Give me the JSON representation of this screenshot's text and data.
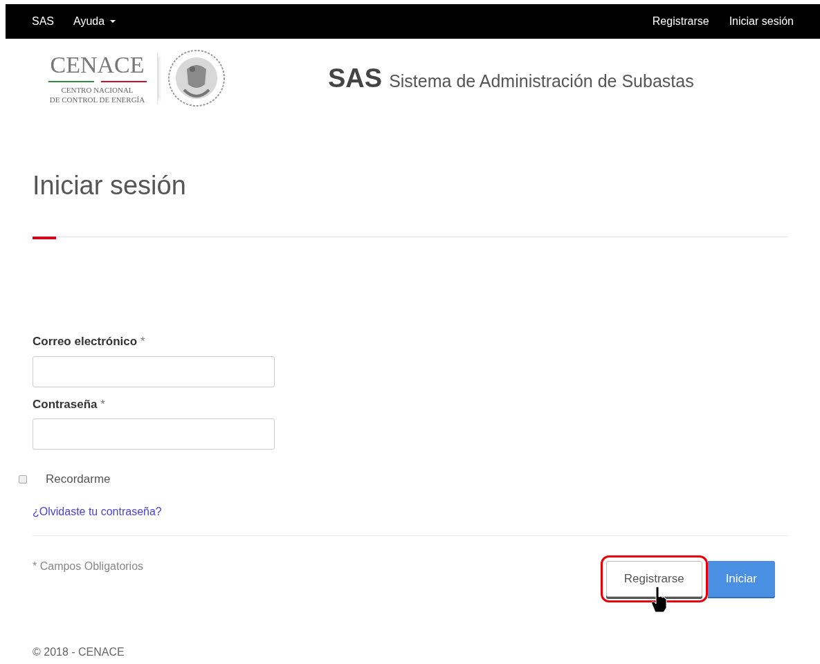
{
  "navbar": {
    "brand": "SAS",
    "menu": {
      "label": "Ayuda"
    },
    "links": [
      "Registrarse",
      "Iniciar sesión"
    ]
  },
  "logo": {
    "name": "CENACE",
    "lines": [
      "CENTRO NACIONAL",
      "DE CONTROL DE ENERGÍA"
    ]
  },
  "app_title": {
    "short": "SAS",
    "full": "Sistema de Administración de Subastas"
  },
  "heading": "Iniciar sesión",
  "fields": [
    {
      "label": "Correo electrónico",
      "required_mark": "*"
    },
    {
      "label": "Contraseña",
      "required_mark": "*"
    }
  ],
  "remember": {
    "label": "Recordarme",
    "checked": false
  },
  "forgot_link": "¿Olvidaste tu contraseña?",
  "required_note": "* Campos Obligatorios",
  "buttons": [
    {
      "label": "Registrarse",
      "kind": "default",
      "highlighted": true
    },
    {
      "label": "Iniciar",
      "kind": "primary",
      "highlighted": false
    }
  ],
  "footer": "© 2018 - CENACE"
}
